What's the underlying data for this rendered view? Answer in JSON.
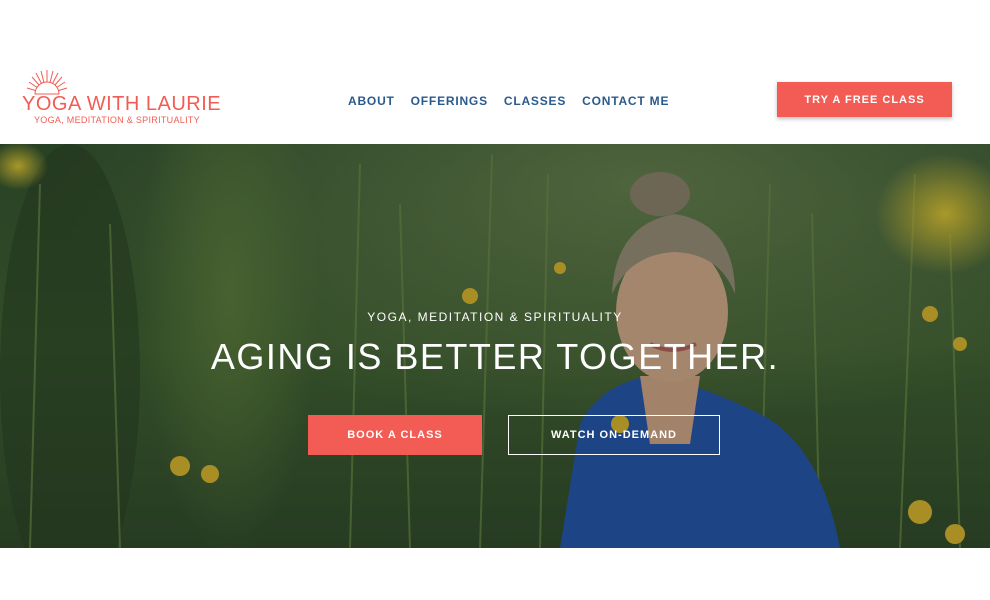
{
  "header": {
    "logo": {
      "title": "YOGA WITH LAURIE",
      "subtitle": "YOGA, MEDITATION & SPIRITUALITY",
      "icon": "sunrise-icon"
    },
    "nav": [
      {
        "label": "ABOUT"
      },
      {
        "label": "OFFERINGS"
      },
      {
        "label": "CLASSES"
      },
      {
        "label": "CONTACT ME"
      }
    ],
    "cta_label": "TRY A FREE CLASS"
  },
  "hero": {
    "kicker": "YOGA, MEDITATION & SPIRITUALITY",
    "title": "AGING IS BETTER TOGETHER.",
    "primary_button": "BOOK A CLASS",
    "secondary_button": "WATCH ON-DEMAND",
    "image": "woman-in-wildflower-meadow"
  },
  "colors": {
    "brand": "#f25c54",
    "nav_text": "#2a5a8c",
    "hero_text": "#ffffff"
  }
}
